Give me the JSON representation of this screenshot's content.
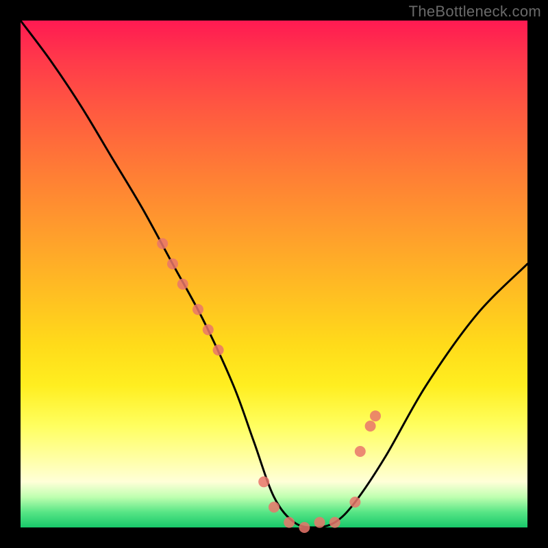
{
  "watermark": "TheBottleneck.com",
  "chart_data": {
    "type": "line",
    "title": "",
    "xlabel": "",
    "ylabel": "",
    "xlim": [
      0,
      100
    ],
    "ylim": [
      0,
      100
    ],
    "series": [
      {
        "name": "bottleneck-curve",
        "x": [
          0,
          6,
          12,
          18,
          24,
          30,
          36,
          42,
          46,
          50,
          54,
          58,
          62,
          66,
          72,
          80,
          90,
          100
        ],
        "values": [
          100,
          92,
          83,
          73,
          63,
          52,
          41,
          28,
          17,
          6,
          1,
          0,
          1,
          5,
          14,
          28,
          42,
          52
        ]
      }
    ],
    "markers": {
      "name": "highlight-points",
      "color": "#e9766b",
      "radius": 8,
      "x": [
        28,
        30,
        32,
        35,
        37,
        39,
        48,
        50,
        53,
        56,
        59,
        62,
        66,
        67,
        69,
        70
      ],
      "values": [
        56,
        52,
        48,
        43,
        39,
        35,
        9,
        4,
        1,
        0,
        1,
        1,
        5,
        15,
        20,
        22
      ]
    }
  }
}
